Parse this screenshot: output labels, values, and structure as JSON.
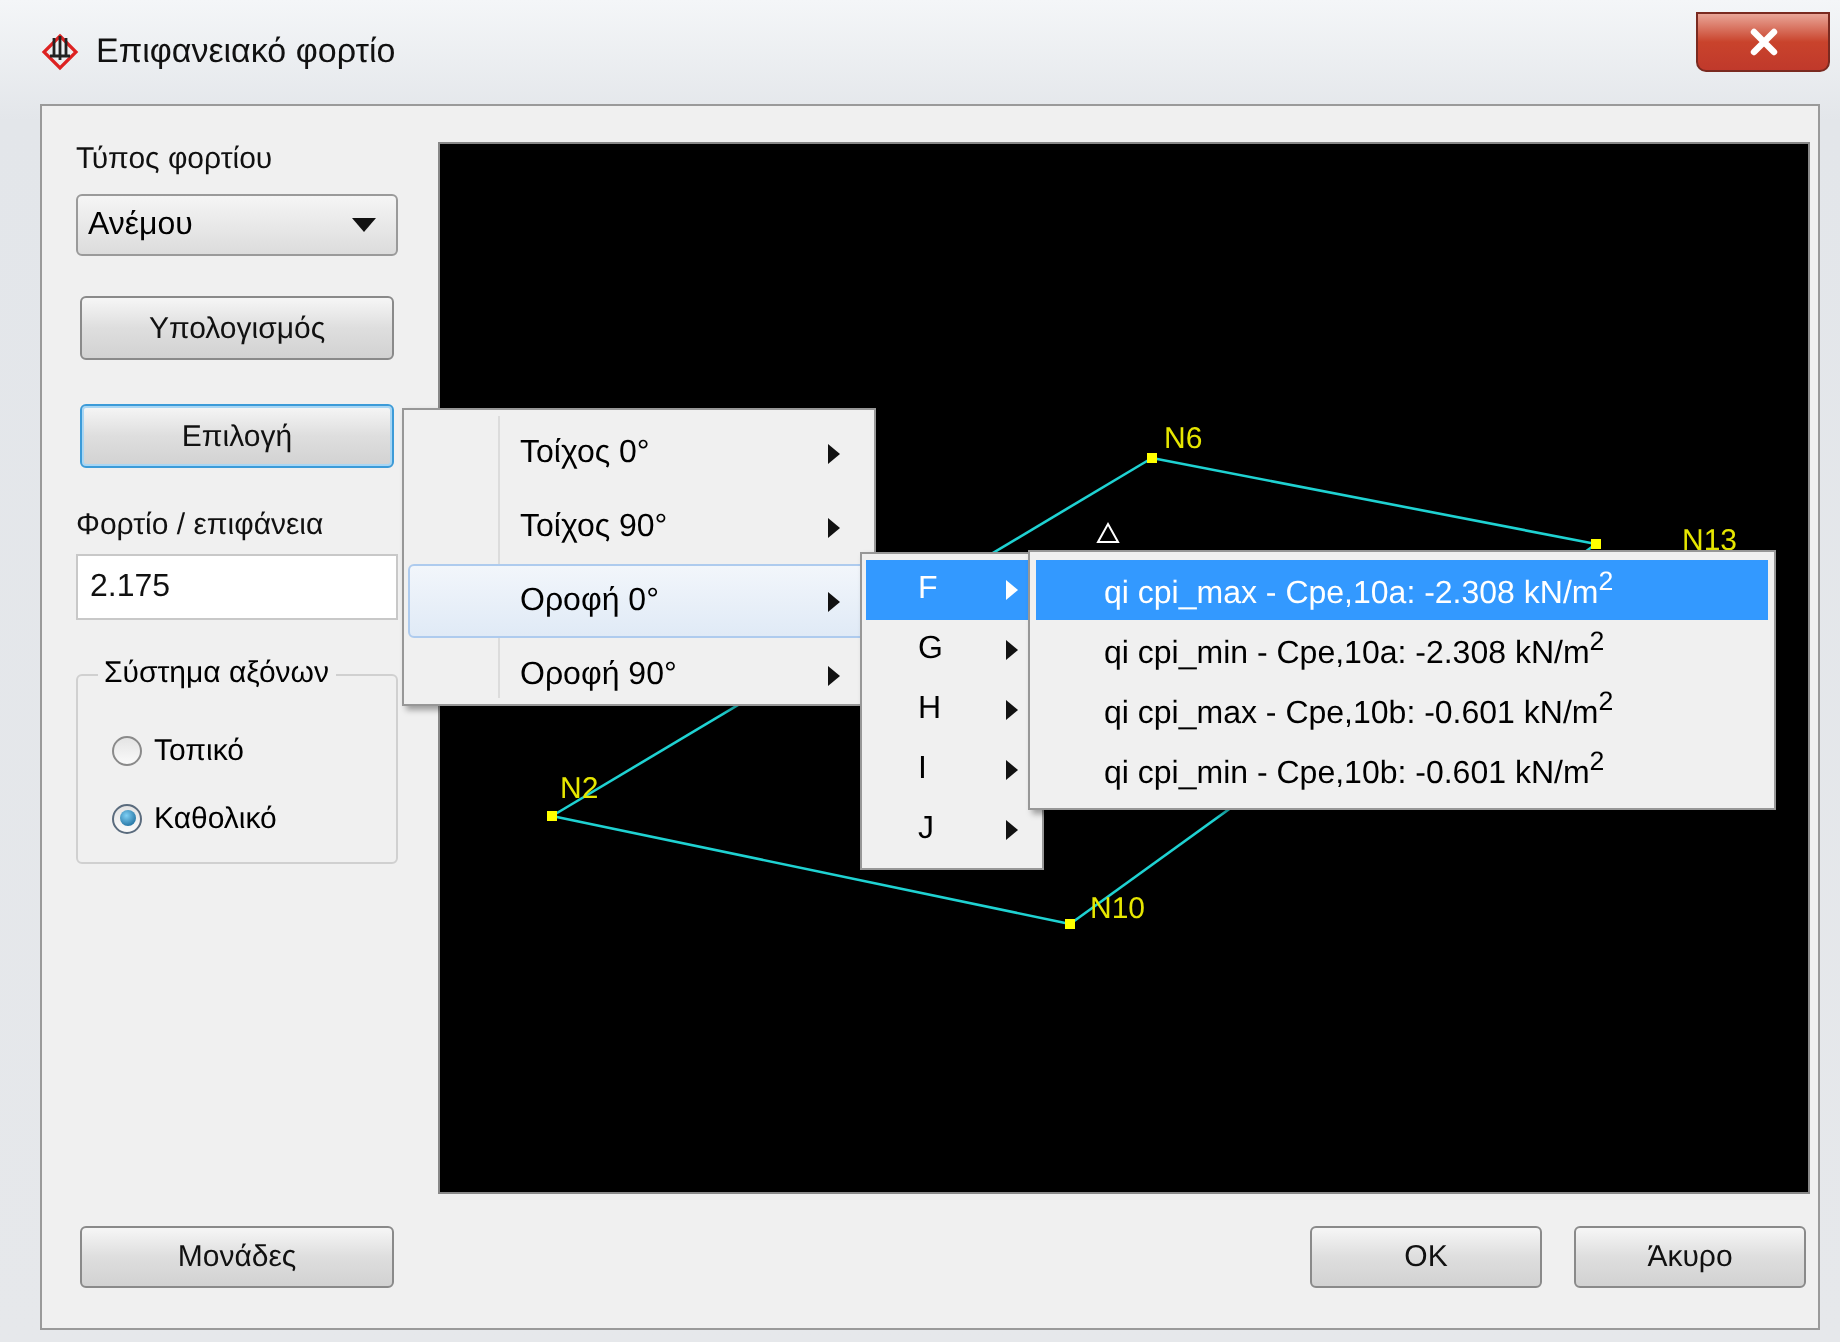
{
  "window": {
    "title": "Επιφανειακό φορτίο"
  },
  "load_type": {
    "label": "Τύπος φορτίου",
    "value": "Ανέμου"
  },
  "calculate_button": "Υπολογισμός",
  "select_button": "Επιλογή",
  "load_per_surface": {
    "label": "Φορτίο / επιφάνεια",
    "value": "2.175"
  },
  "axis_system": {
    "legend": "Σύστημα αξόνων",
    "options": [
      {
        "label": "Τοπικό",
        "selected": false
      },
      {
        "label": "Καθολικό",
        "selected": true
      }
    ]
  },
  "canvas": {
    "nodes": [
      {
        "label": "N6"
      },
      {
        "label": "N13"
      },
      {
        "label": "N2"
      },
      {
        "label": "N10"
      }
    ]
  },
  "menu": {
    "items": [
      {
        "label": "Τοίχος 0°",
        "selected": false
      },
      {
        "label": "Τοίχος 90°",
        "selected": false
      },
      {
        "label": "Οροφή 0°",
        "selected": true
      },
      {
        "label": "Οροφή 90°",
        "selected": false
      }
    ]
  },
  "submenu": {
    "items": [
      {
        "label": "F",
        "selected": true
      },
      {
        "label": "G",
        "selected": false
      },
      {
        "label": "H",
        "selected": false
      },
      {
        "label": "I",
        "selected": false
      },
      {
        "label": "J",
        "selected": false
      }
    ]
  },
  "subsubmenu": {
    "items": [
      {
        "label": "qi cpi_max - Cpe,10a: -2.308 kN/m$^{2}$",
        "selected": true
      },
      {
        "label": "qi cpi_min - Cpe,10a: -2.308 kN/m$^{2}$",
        "selected": false
      },
      {
        "label": "qi cpi_max - Cpe,10b: -0.601 kN/m$^{2}$",
        "selected": false
      },
      {
        "label": "qi cpi_min - Cpe,10b: -0.601 kN/m$^{2}$",
        "selected": false
      }
    ]
  },
  "buttons": {
    "units": "Μονάδες",
    "ok": "OK",
    "cancel": "Άκυρο"
  }
}
